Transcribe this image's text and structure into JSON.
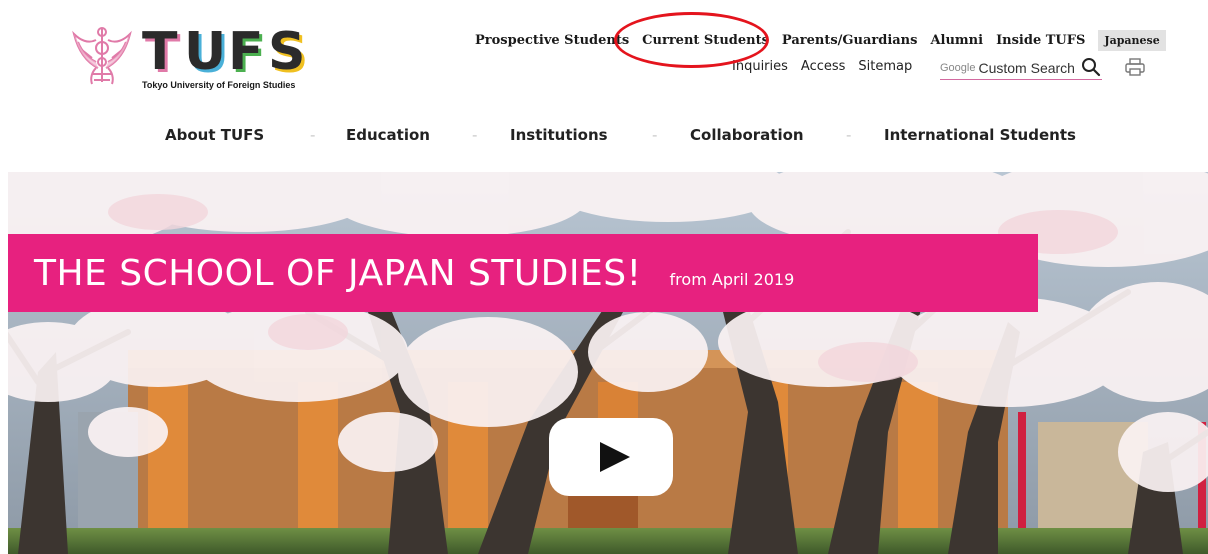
{
  "logo": {
    "letters": [
      "T",
      "U",
      "F",
      "S"
    ],
    "subtitle": "Tokyo University of Foreign Studies",
    "emblem_icon": "tufs-emblem-icon",
    "colors": {
      "T": "#2b2b2b",
      "U": "#2b2b2b",
      "F": "#2b2b2b",
      "S": "#2b2b2b",
      "emblem": "#e07aa8"
    }
  },
  "top_nav": {
    "items": [
      "Prospective Students",
      "Current Students",
      "Parents/Guardians",
      "Alumni",
      "Inside TUFS"
    ],
    "language": "Japanese"
  },
  "utility_nav": {
    "items": [
      "Inquiries",
      "Access",
      "Sitemap"
    ]
  },
  "search": {
    "brand": "Google",
    "placeholder": "Custom Search",
    "icon": "search-icon"
  },
  "print": {
    "icon": "printer-icon"
  },
  "main_nav": {
    "items": [
      "About TUFS",
      "Education",
      "Institutions",
      "Collaboration",
      "International Students"
    ],
    "separator": "-"
  },
  "hero": {
    "title": "THE SCHOOL OF JAPAN STUDIES!",
    "subtitle": "from April 2019",
    "play_icon": "play-icon",
    "banner_color": "#e7217f"
  },
  "annotation": {
    "color": "#e4141d",
    "target": "Current Students"
  }
}
